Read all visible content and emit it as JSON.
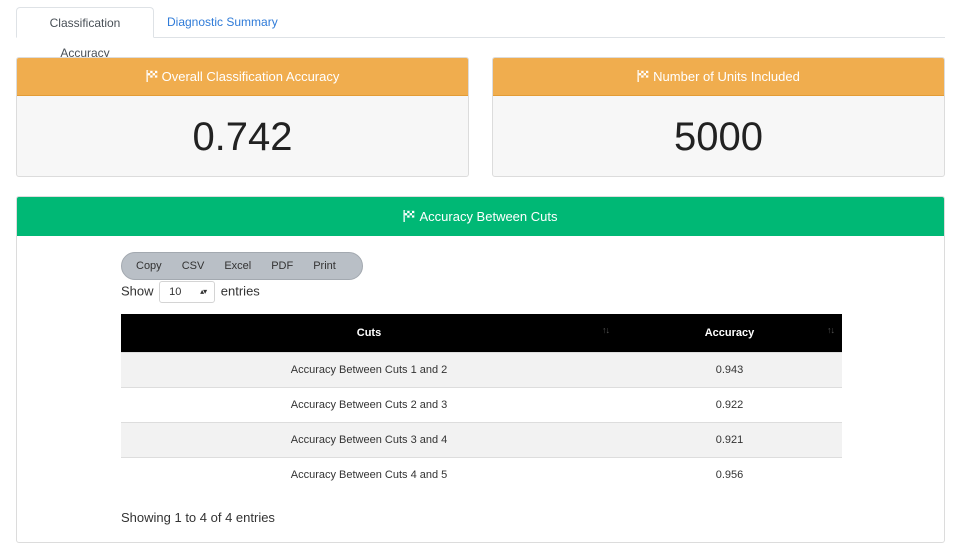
{
  "tabs": [
    {
      "label": "Classification Accuracy",
      "active": true
    },
    {
      "label": "Diagnostic Summary",
      "active": false
    }
  ],
  "value_boxes": {
    "accuracy": {
      "title": "Overall Classification Accuracy",
      "value": "0.742",
      "color": "#f0ad4e",
      "icon": "flag-checkered-icon"
    },
    "units": {
      "title": "Number of Units Included",
      "value": "5000",
      "color": "#f0ad4e",
      "icon": "flag-checkered-icon"
    }
  },
  "panel": {
    "title": "Accuracy Between Cuts",
    "color": "#00b875",
    "icon": "flag-checkered-icon",
    "buttons": [
      "Copy",
      "CSV",
      "Excel",
      "PDF",
      "Print"
    ],
    "length": {
      "prefix": "Show",
      "value": "10",
      "suffix": "entries"
    },
    "columns": [
      "Cuts",
      "Accuracy"
    ],
    "rows": [
      {
        "cuts": "Accuracy Between Cuts 1 and 2",
        "accuracy": "0.943"
      },
      {
        "cuts": "Accuracy Between Cuts 2 and 3",
        "accuracy": "0.922"
      },
      {
        "cuts": "Accuracy Between Cuts 3 and 4",
        "accuracy": "0.921"
      },
      {
        "cuts": "Accuracy Between Cuts 4 and 5",
        "accuracy": "0.956"
      }
    ],
    "info": "Showing 1 to 4 of 4 entries"
  }
}
